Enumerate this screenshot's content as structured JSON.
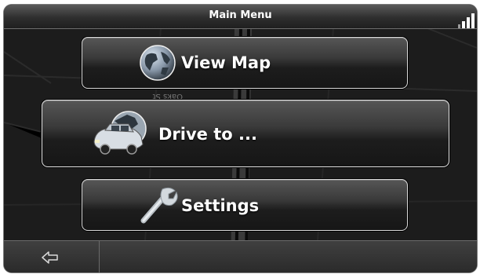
{
  "header": {
    "title": "Main Menu",
    "signal_icon": "signal-strength-icon"
  },
  "menu": {
    "view_map": {
      "label": "View Map",
      "icon": "globe-icon"
    },
    "drive_to": {
      "label": "Drive to ...",
      "icon": "car-icon"
    },
    "settings": {
      "label": "Settings",
      "icon": "wrench-icon"
    }
  },
  "map": {
    "street_label": "Oaks St"
  },
  "footer": {
    "back_icon": "back-arrow-icon"
  },
  "colors": {
    "button_border": "#d9d9d9",
    "button_fill_top": "#565656",
    "button_fill_bottom": "#161616",
    "background": "#1b1b1b"
  }
}
